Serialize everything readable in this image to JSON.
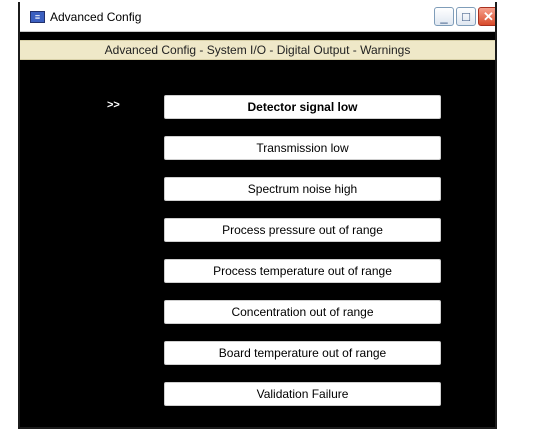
{
  "window": {
    "title": "Advanced Config",
    "app_icon": "app-icon",
    "controls": {
      "minimize": "_",
      "maximize": "□",
      "close": "✕"
    }
  },
  "breadcrumb": "Advanced Config - System I/O - Digital Output - Warnings",
  "selection_marker": ">>",
  "warnings": [
    {
      "label": "Detector signal low",
      "selected": true
    },
    {
      "label": "Transmission low",
      "selected": false
    },
    {
      "label": "Spectrum noise high",
      "selected": false
    },
    {
      "label": "Process pressure out of range",
      "selected": false
    },
    {
      "label": "Process temperature out of range",
      "selected": false
    },
    {
      "label": "Concentration out of range",
      "selected": false
    },
    {
      "label": "Board temperature out of range",
      "selected": false
    },
    {
      "label": "Validation Failure",
      "selected": false
    }
  ]
}
